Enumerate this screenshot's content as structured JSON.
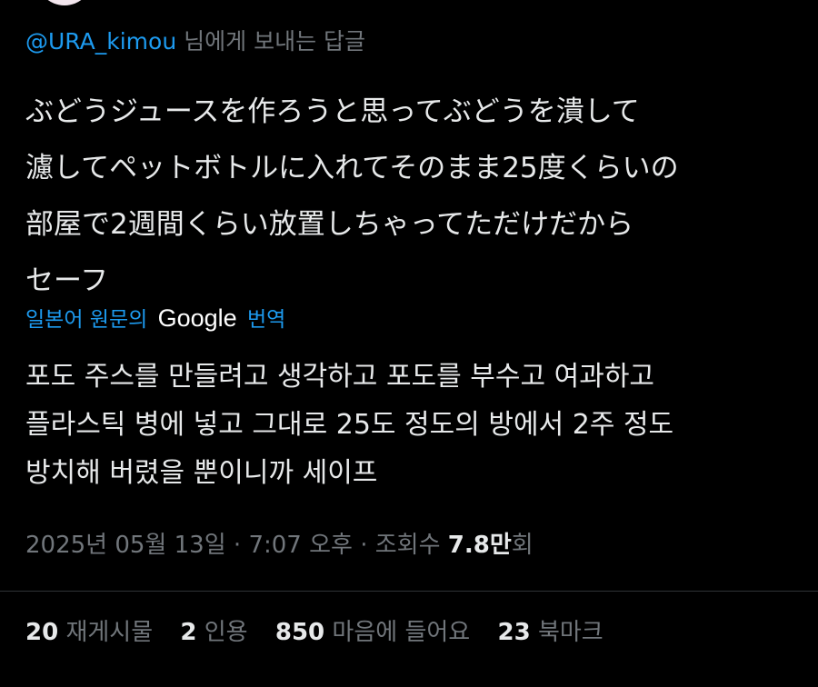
{
  "reply": {
    "handle": "@URA_kimou",
    "suffix": " 님에게 보내는 답글"
  },
  "tweet": {
    "lines": [
      "ぶどうジュースを作ろうと思ってぶどうを潰して",
      "濾してペットボトルに入れてそのまま25度くらいの",
      "部屋で2週間くらい放置しちゃってただけだから",
      "セーフ"
    ]
  },
  "translation": {
    "prefix": "일본어 원문의",
    "provider": "Google",
    "suffix": "번역",
    "lines": [
      "포도 주스를 만들려고 생각하고 포도를 부수고 여과하고",
      "플라스틱 병에 넣고 그대로 25도 정도의 방에서 2주 정도",
      "방치해 버렸을 뿐이니까 세이프"
    ]
  },
  "meta": {
    "date": "2025년 05월 13일",
    "separator": " · ",
    "time": "7:07 오후",
    "views_label": "조회수 ",
    "views_number": "7.8",
    "views_unit": "만",
    "views_suffix": "회"
  },
  "stats": {
    "retweets": {
      "count": "20",
      "label": "재게시물"
    },
    "quotes": {
      "count": "2",
      "label": "인용"
    },
    "likes": {
      "count": "850",
      "label": "마음에 들어요"
    },
    "bookmarks": {
      "count": "23",
      "label": "북마크"
    }
  },
  "colors": {
    "background": "#000000",
    "text": "#e7e9ea",
    "muted": "#71767b",
    "accent": "#1d9bf0"
  }
}
